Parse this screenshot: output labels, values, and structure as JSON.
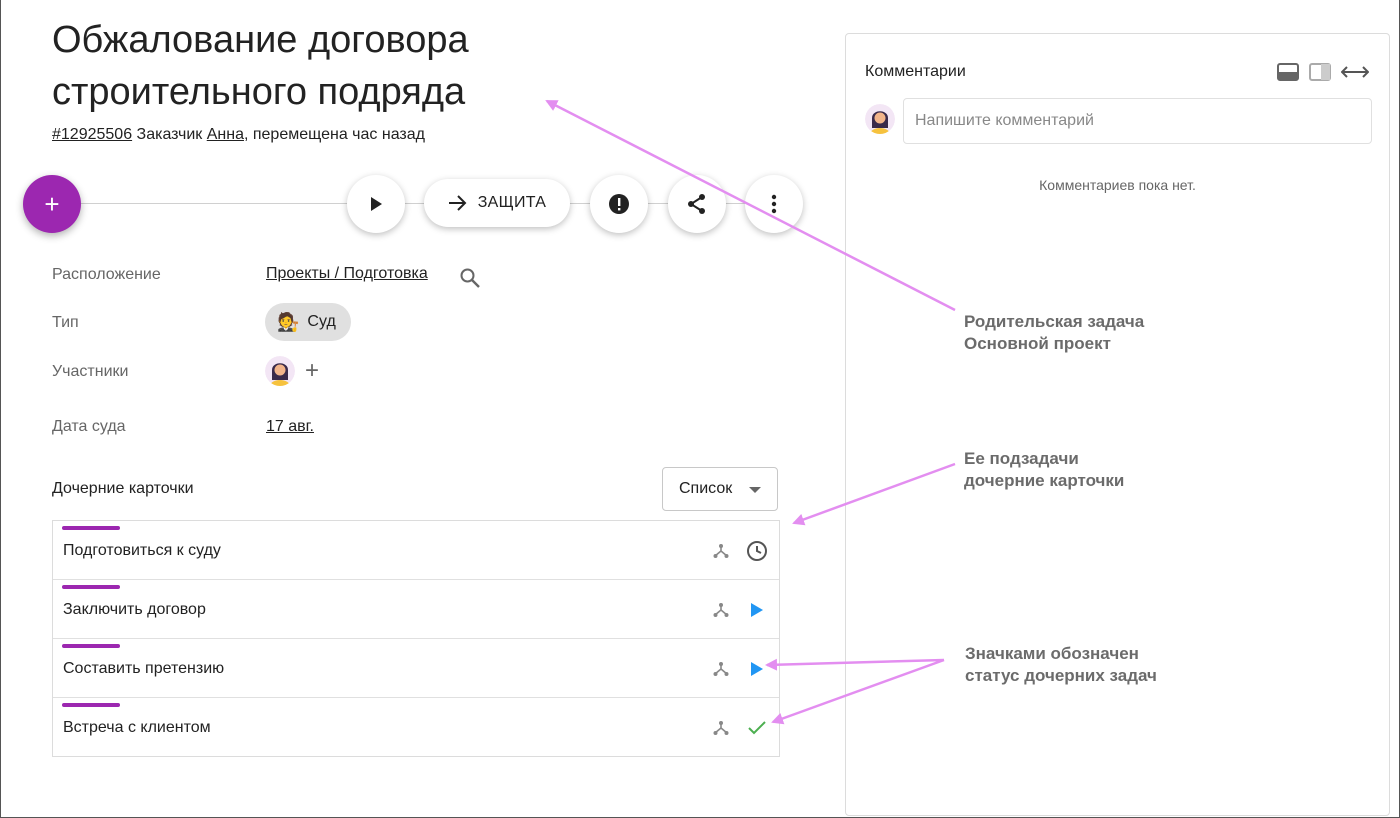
{
  "task": {
    "title": "Обжалование договора строительного подряда",
    "id_link": "#12925506",
    "customer_prefix": "Заказчик",
    "customer_name": "Анна",
    "moved_text": ", перемещена час назад"
  },
  "toolbar": {
    "add_label": "+",
    "stage_label": "ЗАЩИТА"
  },
  "fields": {
    "location_label": "Расположение",
    "location_value": "Проекты / Подготовка",
    "type_label": "Тип",
    "type_value": "Суд",
    "type_emoji": "🧑‍⚖️",
    "participants_label": "Участники",
    "participants_add": "+",
    "court_date_label": "Дата суда",
    "court_date_value": "17 авг."
  },
  "subtasks": {
    "heading": "Дочерние карточки",
    "view_select": "Список",
    "items": [
      {
        "label": "Подготовиться к суду",
        "status": "clock-icon"
      },
      {
        "label": "Заключить договор",
        "status": "play-icon"
      },
      {
        "label": "Составить претензию",
        "status": "play-icon"
      },
      {
        "label": "Встреча с клиентом",
        "status": "check-icon"
      }
    ]
  },
  "comments": {
    "title": "Комментарии",
    "input_placeholder": "Напишите комментарий",
    "empty_text": "Комментариев пока нет."
  },
  "annotations": {
    "parent_line1": "Родительская задача",
    "parent_line2": "Основной проект",
    "children_line1": "Ее подзадачи",
    "children_line2": "дочерние карточки",
    "status_line1": "Значками обозначен",
    "status_line2": "статус дочерних задач"
  },
  "colors": {
    "accent": "#9c27b0",
    "play": "#2196f3",
    "done": "#4caf50",
    "annotation_arrow": "#e38ef0"
  }
}
